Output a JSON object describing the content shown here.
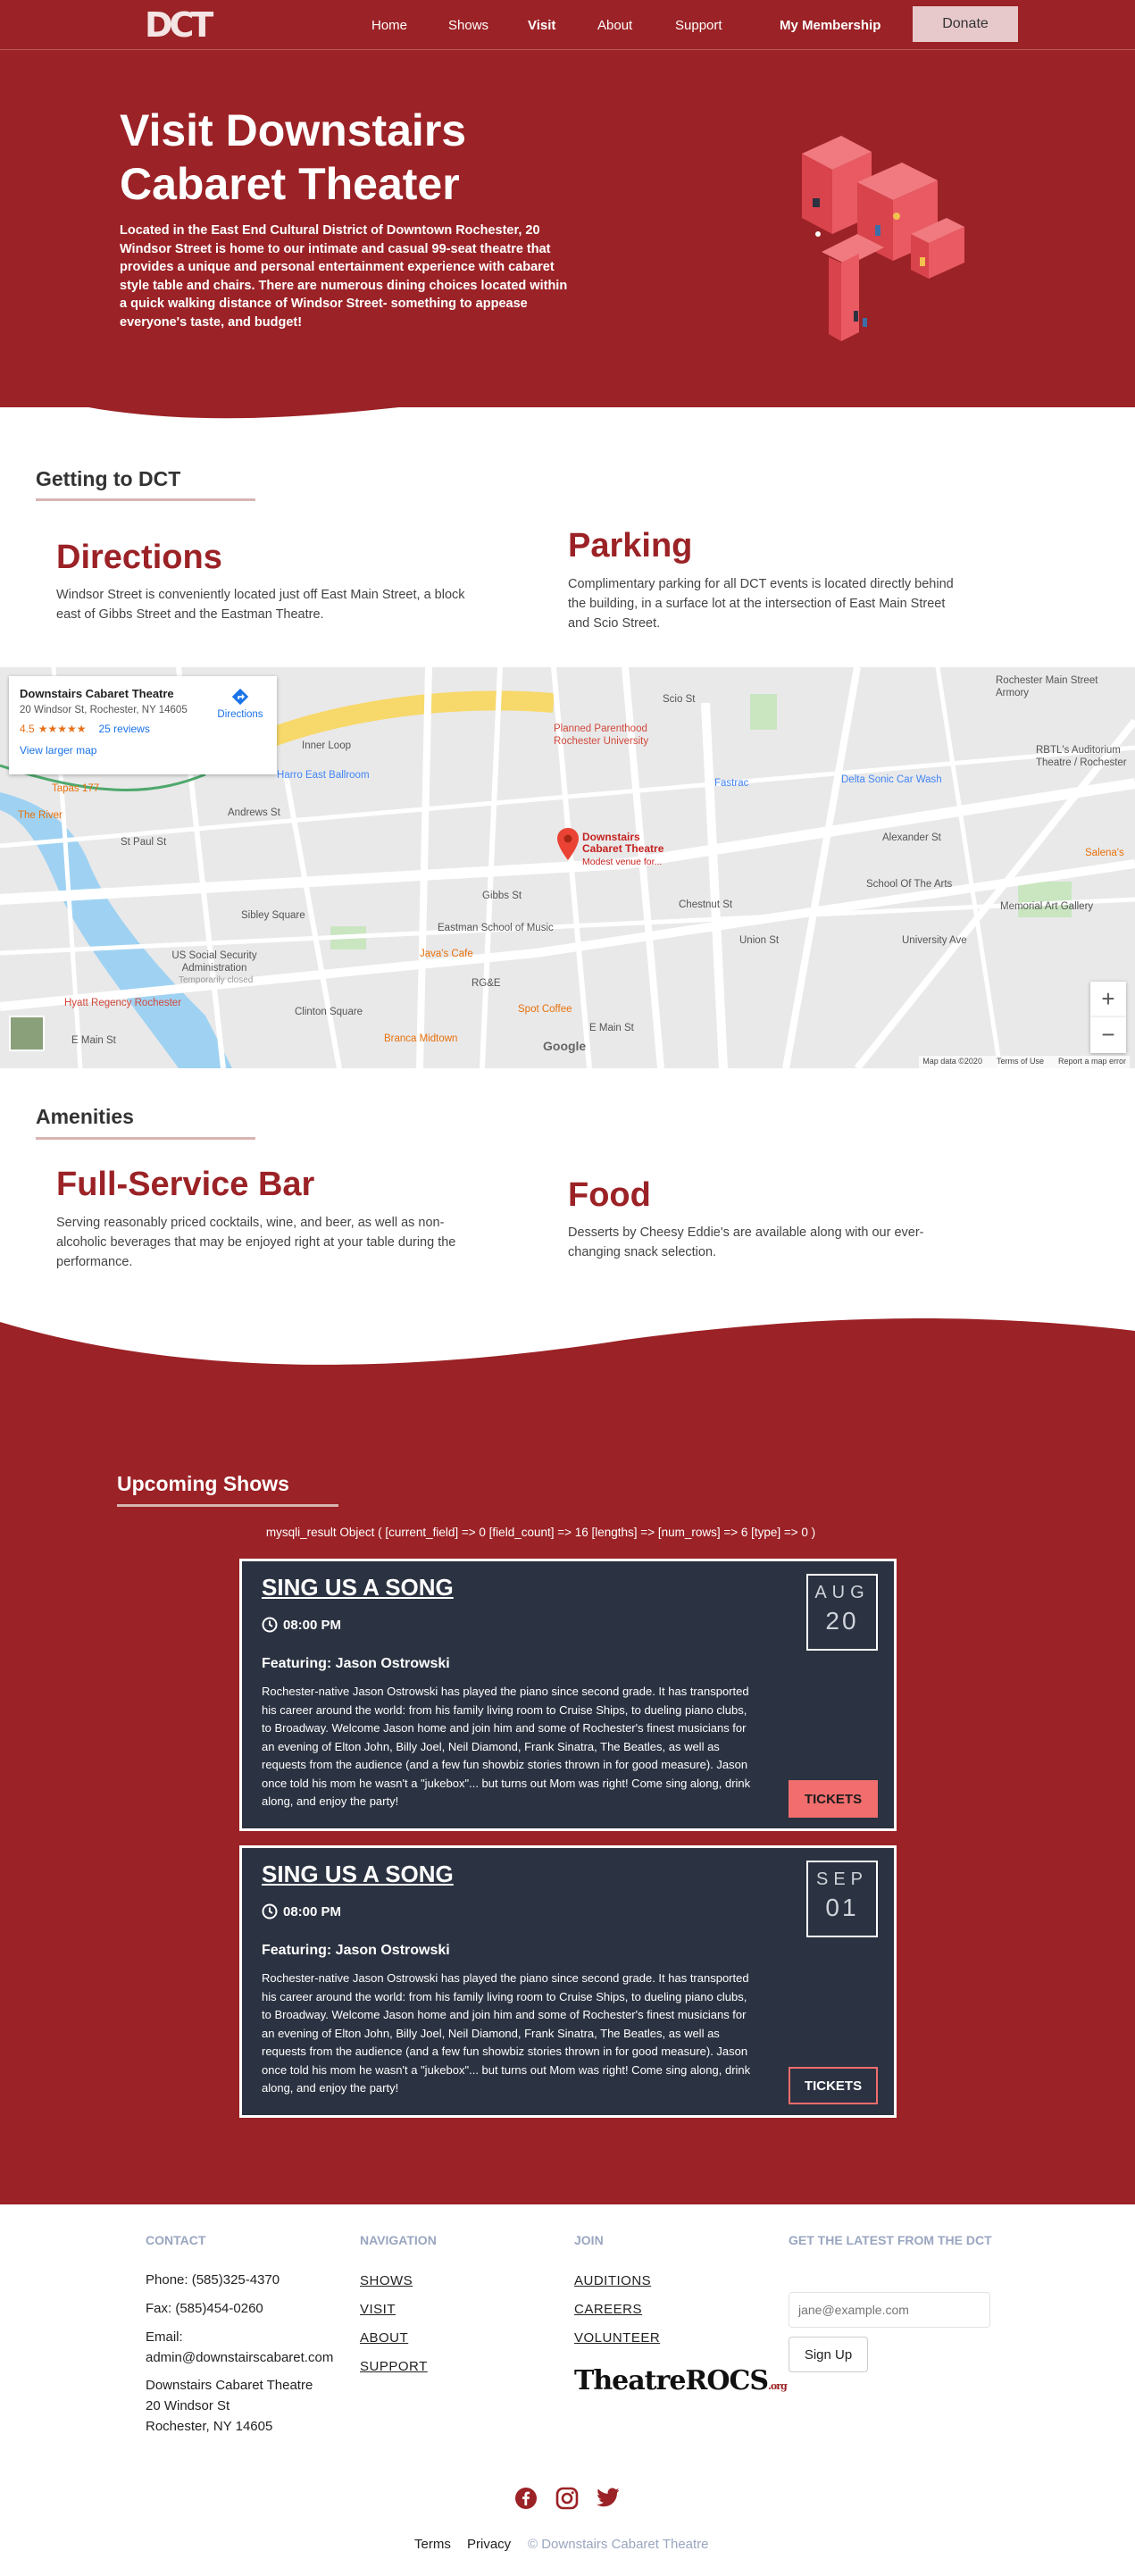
{
  "header": {
    "logo": "DCT",
    "nav": [
      "Home",
      "Shows",
      "Visit",
      "About",
      "Support"
    ],
    "membership": "My Membership",
    "donate": "Donate"
  },
  "hero": {
    "title": "Visit Downstairs Cabaret Theater",
    "text": "Located in the East End Cultural District of Downtown Rochester, 20 Windsor Street is home to our intimate and casual 99-seat theatre that provides a unique and personal entertainment experience with cabaret style table and chairs. There are numerous dining choices located within a quick walking distance of Windsor Street- something to appease everyone's taste, and budget!"
  },
  "getting": {
    "title": "Getting to DCT",
    "directions_h": "Directions",
    "directions_p": "Windsor Street is conveniently located just off East Main Street, a block east of Gibbs Street and the Eastman Theatre.",
    "parking_h": "Parking",
    "parking_p": "Complimentary parking for all DCT events is located directly behind the building, in a surface lot at the intersection of East Main Street and Scio Street."
  },
  "map": {
    "card_title": "Downstairs Cabaret Theatre",
    "card_address": "20 Windsor St, Rochester, NY 14605",
    "rating": "4.5",
    "stars": "★★★★★",
    "reviews": "25 reviews",
    "larger": "View larger map",
    "directions": "Directions",
    "pin_label": "Downstairs Cabaret Theatre",
    "pin_sub": "Modest venue for...",
    "labels": [
      "Inner Loop",
      "Planned Parenthood Rochester University",
      "Harro East Ballroom",
      "Tapas 177",
      "The River",
      "Andrews St",
      "St Paul St",
      "Sibley Square",
      "US Social Security Administration",
      "Temporarily closed",
      "Hyatt Regency Rochester",
      "E Main St",
      "Eastman School of Music",
      "Java's Cafe",
      "RG&E",
      "Spot Coffee",
      "Branca Midtown",
      "Fastrac",
      "Delta Sonic Car Wash",
      "School Of The Arts",
      "Memorial Art Gallery",
      "University Ave",
      "Rochester Main Street Armory",
      "RBTL's Auditorium Theatre / Rochester",
      "Salena's",
      "Union St",
      "Scio St",
      "Alexander St",
      "Clinton Square",
      "Chestnut St",
      "Gibbs St",
      "E Main St"
    ],
    "footer": [
      "Map data ©2020",
      "Terms of Use",
      "Report a map error"
    ],
    "google": "Google"
  },
  "amenities": {
    "title": "Amenities",
    "bar_h": "Full-Service Bar",
    "bar_p": "Serving reasonably priced cocktails, wine, and beer, as well as non-alcoholic beverages that may be enjoyed right at your table during the performance.",
    "food_h": "Food",
    "food_p": "Desserts by Cheesy Eddie's are available along with our ever-changing snack selection."
  },
  "shows": {
    "title": "Upcoming Shows",
    "debug": "mysqli_result Object ( [current_field] => 0 [field_count] => 16 [lengths] => [num_rows] => 6 [type] => 0 )",
    "items": [
      {
        "title": "SING US A SONG",
        "time": "08:00 PM",
        "featuring": "Featuring: Jason Ostrowski",
        "desc": "Rochester-native Jason Ostrowski has played the piano since second grade. It has transported his career around the world: from his family living room to Cruise Ships, to dueling piano clubs, to Broadway. Welcome Jason home and join him and some of Rochester's finest musicians for an evening of Elton John, Billy Joel, Neil Diamond, Frank Sinatra, The Beatles, as well as requests from the audience (and a few fun showbiz stories thrown in for good measure). Jason once told his mom he wasn't a \"jukebox\"... but turns out Mom was right! Come sing along, drink along, and enjoy the party!",
        "month": "AUG",
        "day": "20",
        "tickets": "TICKETS"
      },
      {
        "title": "SING US A SONG",
        "time": "08:00 PM",
        "featuring": "Featuring: Jason Ostrowski",
        "desc": "Rochester-native Jason Ostrowski has played the piano since second grade. It has transported his career around the world: from his family living room to Cruise Ships, to dueling piano clubs, to Broadway. Welcome Jason home and join him and some of Rochester's finest musicians for an evening of Elton John, Billy Joel, Neil Diamond, Frank Sinatra, The Beatles, as well as requests from the audience (and a few fun showbiz stories thrown in for good measure). Jason once told his mom he wasn't a \"jukebox\"... but turns out Mom was right! Come sing along, drink along, and enjoy the party!",
        "month": "SEP",
        "day": "01",
        "tickets": "TICKETS"
      }
    ]
  },
  "footer": {
    "contact_h": "CONTACT",
    "phone": "Phone: (585)325-4370",
    "fax": "Fax: (585)454-0260",
    "email_label": "Email:",
    "email": "admin@downstairscabaret.com",
    "addr1": "Downstairs Cabaret Theatre",
    "addr2": "20 Windsor St",
    "addr3": "Rochester, NY 14605",
    "nav_h": "NAVIGATION",
    "nav": [
      "SHOWS",
      "VISIT",
      "ABOUT",
      "SUPPORT"
    ],
    "join_h": "JOIN",
    "join": [
      "AUDITIONS",
      "CAREERS",
      "VOLUNTEER"
    ],
    "theatre_rocs": "TheatreROCS",
    "theatre_rocs_org": ".org",
    "latest_h": "GET THE LATEST FROM THE DCT",
    "email_placeholder": "jane@example.com",
    "signup": "Sign Up",
    "bottom": [
      "Terms",
      "Privacy"
    ],
    "copyright": "© Downstairs Cabaret Theatre"
  },
  "colors": {
    "maroon": "#9b2226",
    "navy": "#2b3241",
    "salmon": "#f26d6d",
    "beige": "#d7b5b3"
  },
  "icons": [
    "clock-icon",
    "facebook-icon",
    "instagram-icon",
    "twitter-icon",
    "map-pin-icon",
    "directions-icon"
  ]
}
